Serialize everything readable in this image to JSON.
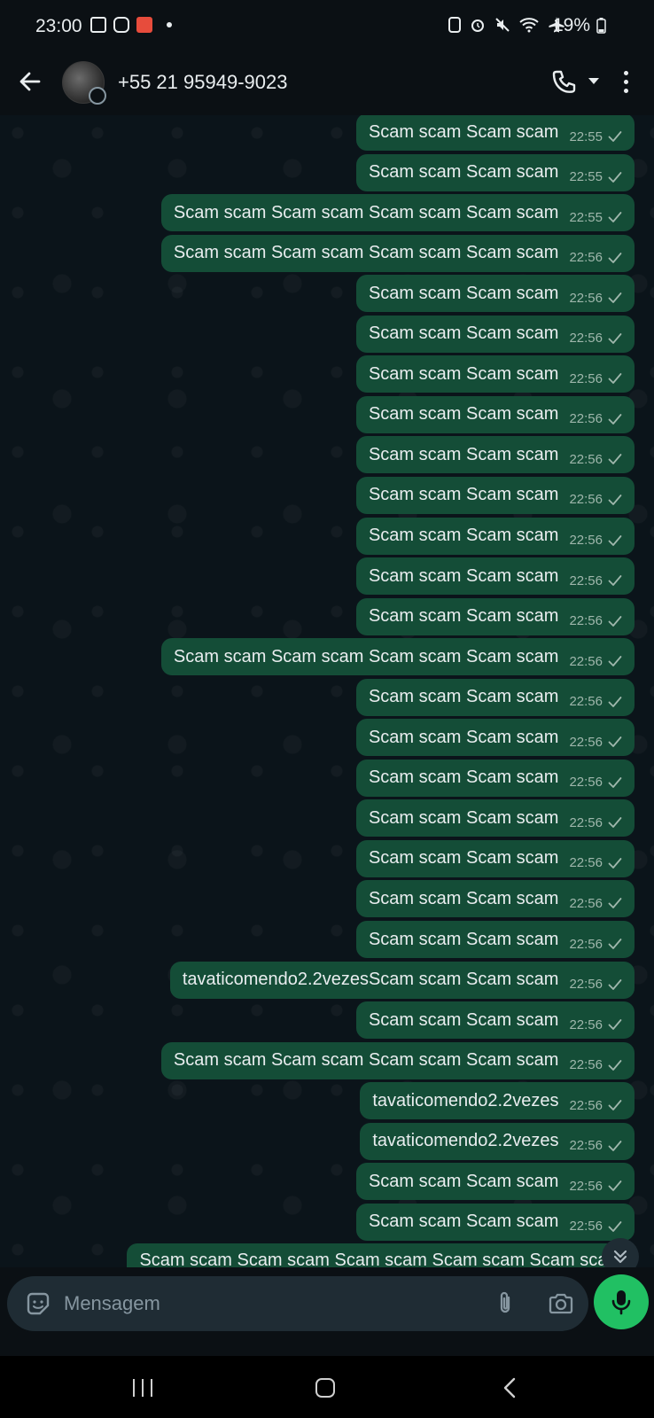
{
  "status_bar": {
    "time": "23:00",
    "battery": "19%",
    "left_icons": [
      "gallery-icon",
      "instagram-icon",
      "app-icon"
    ],
    "right_icons": [
      "nfc-icon",
      "alarm-icon",
      "mute-icon",
      "wifi-icon",
      "airplane-icon",
      "battery-icon"
    ]
  },
  "header": {
    "contact_name": "+55 21 95949-9023"
  },
  "messages": [
    {
      "text": "Scam scam Scam scam",
      "time": "22:55"
    },
    {
      "text": "Scam scam Scam scam",
      "time": "22:55"
    },
    {
      "text": "Scam scam Scam scam Scam scam Scam scam",
      "time": "22:55"
    },
    {
      "text": "Scam scam Scam scam Scam scam Scam scam",
      "time": "22:56"
    },
    {
      "text": "Scam scam Scam scam",
      "time": "22:56"
    },
    {
      "text": "Scam scam Scam scam",
      "time": "22:56"
    },
    {
      "text": "Scam scam Scam scam",
      "time": "22:56"
    },
    {
      "text": "Scam scam Scam scam",
      "time": "22:56"
    },
    {
      "text": "Scam scam Scam scam",
      "time": "22:56"
    },
    {
      "text": "Scam scam Scam scam",
      "time": "22:56"
    },
    {
      "text": "Scam scam Scam scam",
      "time": "22:56"
    },
    {
      "text": "Scam scam Scam scam",
      "time": "22:56"
    },
    {
      "text": "Scam scam Scam scam",
      "time": "22:56"
    },
    {
      "text": "Scam scam Scam scam Scam scam Scam scam",
      "time": "22:56"
    },
    {
      "text": "Scam scam Scam scam",
      "time": "22:56"
    },
    {
      "text": "Scam scam Scam scam",
      "time": "22:56"
    },
    {
      "text": "Scam scam Scam scam",
      "time": "22:56"
    },
    {
      "text": "Scam scam Scam scam",
      "time": "22:56"
    },
    {
      "text": "Scam scam Scam scam",
      "time": "22:56"
    },
    {
      "text": "Scam scam Scam scam",
      "time": "22:56"
    },
    {
      "text": "Scam scam Scam scam",
      "time": "22:56"
    },
    {
      "text": "tavaticomendo2.2vezesScam scam Scam scam",
      "time": "22:56"
    },
    {
      "text": "Scam scam Scam scam",
      "time": "22:56"
    },
    {
      "text": "Scam scam Scam scam Scam scam Scam scam",
      "time": "22:56"
    },
    {
      "text": "tavaticomendo2.2vezes",
      "time": "22:56"
    },
    {
      "text": "tavaticomendo2.2vezes",
      "time": "22:56"
    },
    {
      "text": "Scam scam Scam scam",
      "time": "22:56"
    },
    {
      "text": "Scam scam Scam scam",
      "time": "22:56"
    },
    {
      "text": "Scam scam Scam scam Scam scam Scam scam Scam scam",
      "time": ""
    }
  ],
  "input": {
    "placeholder": "Mensagem",
    "value": ""
  },
  "colors": {
    "outgoing_bubble": "#144d37",
    "accent_green": "#21c063",
    "background": "#0b141a"
  }
}
